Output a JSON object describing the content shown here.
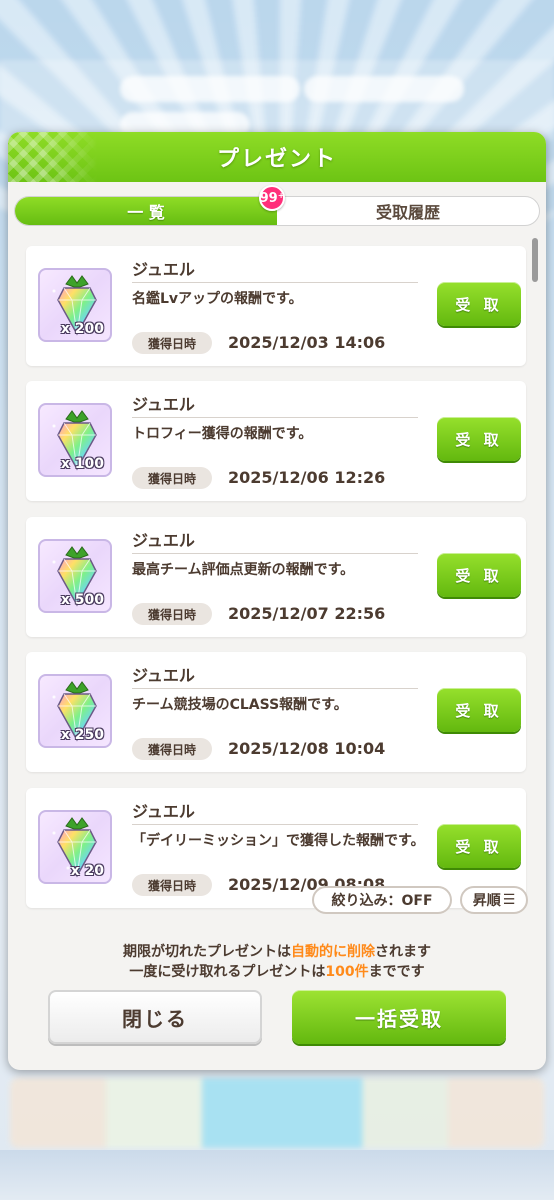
{
  "dialog": {
    "title": "プレゼント",
    "tabs": [
      {
        "label": "一 覧",
        "active": true
      },
      {
        "label": "受取履歴",
        "active": false
      }
    ],
    "badge": {
      "count": "99",
      "suffix": "+"
    }
  },
  "presents": [
    {
      "name": "ジュエル",
      "quantity": "x 200",
      "description": "名鑑Lvアップの報酬です。",
      "date_label": "獲得日時",
      "date": "2025/12/03 14:06",
      "button": "受 取"
    },
    {
      "name": "ジュエル",
      "quantity": "x 100",
      "description": "トロフィー獲得の報酬です。",
      "date_label": "獲得日時",
      "date": "2025/12/06 12:26",
      "button": "受 取"
    },
    {
      "name": "ジュエル",
      "quantity": "x 500",
      "description": "最高チーム評価点更新の報酬です。",
      "date_label": "獲得日時",
      "date": "2025/12/07 22:56",
      "button": "受 取"
    },
    {
      "name": "ジュエル",
      "quantity": "x 250",
      "description": "チーム競技場のCLASS報酬です。",
      "date_label": "獲得日時",
      "date": "2025/12/08 10:04",
      "button": "受 取"
    },
    {
      "name": "ジュエル",
      "quantity": "x 20",
      "description": "「デイリーミッション」で獲得した報酬です。",
      "date_label": "獲得日時",
      "date": "2025/12/09 08:08",
      "button": "受 取"
    }
  ],
  "controls": {
    "filter": "絞り込み：OFF",
    "sort": "昇順"
  },
  "notes": {
    "line1_pre": "期限が切れたプレゼントは",
    "line1_hl": "自動的に削除",
    "line1_post": "されます",
    "line2_pre": "一度に受け取れるプレゼントは",
    "line2_hl": "100件",
    "line2_post": "までです"
  },
  "buttons": {
    "close": "閉じる",
    "bulk": "一括受取"
  },
  "colors": {
    "accent_green": "#6dc414",
    "highlight_orange": "#ff8a1a",
    "badge_pink": "#ff2f7a",
    "text_brown": "#4c3b30"
  }
}
